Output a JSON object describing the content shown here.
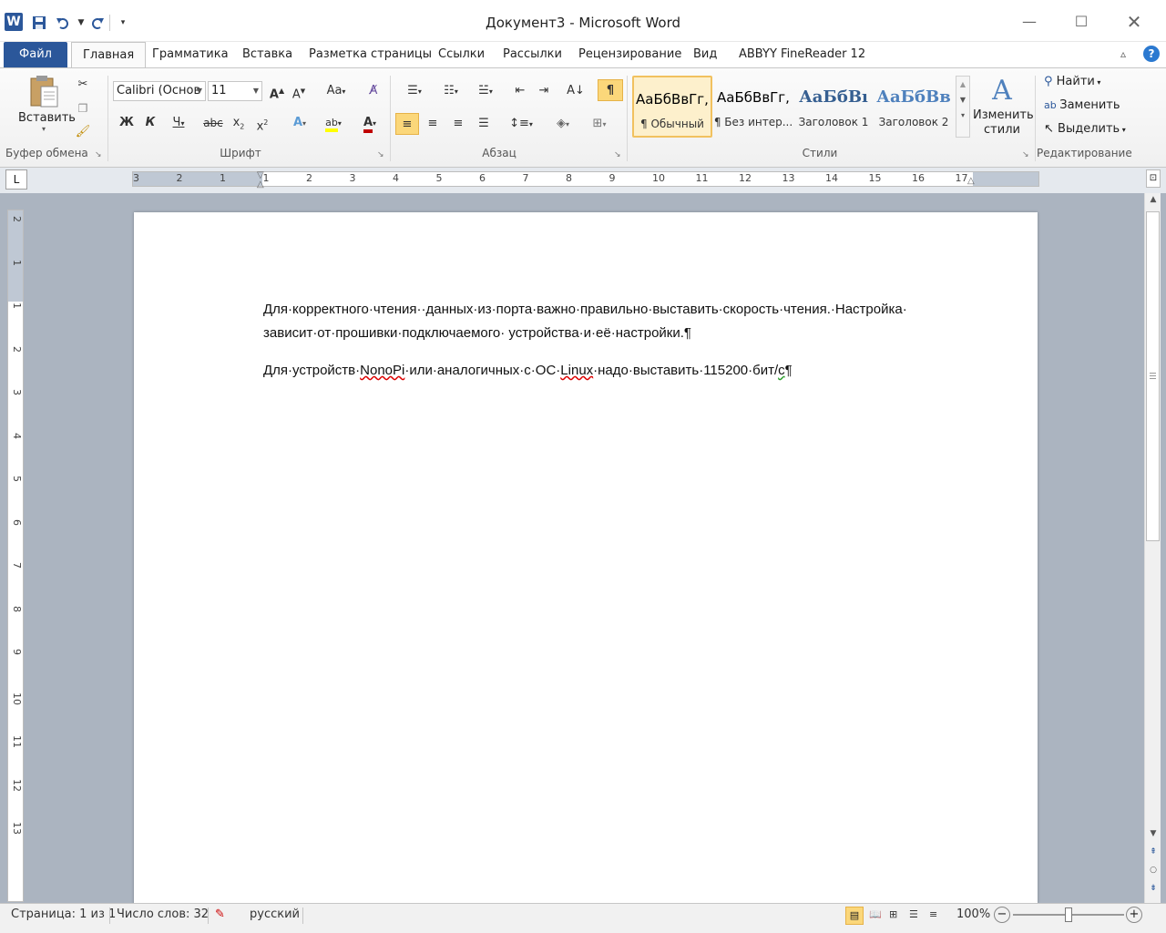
{
  "window": {
    "title": "Документ3 - Microsoft Word",
    "minimize_icon": "minimize-icon",
    "maximize_icon": "maximize-icon",
    "close_icon": "close-icon"
  },
  "qat": {
    "save_icon": "save-icon",
    "undo_icon": "undo-icon",
    "redo_icon": "redo-icon",
    "customize_icon": "chevron-down-icon"
  },
  "tabs": [
    "Файл",
    "Главная",
    "Грамматика",
    "Вставка",
    "Разметка страницы",
    "Ссылки",
    "Рассылки",
    "Рецензирование",
    "Вид",
    "ABBYY FineReader 12"
  ],
  "ribbon": {
    "clipboard": {
      "label": "Буфер обмена",
      "paste": "Вставить"
    },
    "font": {
      "label": "Шрифт",
      "name": "Calibri (Основ",
      "size": "11",
      "case_btn": "Аа"
    },
    "paragraph": {
      "label": "Абзац"
    },
    "styles": {
      "label": "Стили",
      "items": [
        {
          "sample": "АаБбВвГг,",
          "name": "¶ Обычный",
          "color": "#000000"
        },
        {
          "sample": "АаБбВвГг,",
          "name": "¶ Без интер...",
          "color": "#000000"
        },
        {
          "sample": "АаБбВı",
          "name": "Заголовок 1",
          "color": "#365f91"
        },
        {
          "sample": "АаБбВв",
          "name": "Заголовок 2",
          "color": "#4f81bd"
        }
      ],
      "change": "Изменить стили"
    },
    "editing": {
      "label": "Редактирование",
      "find": "Найти",
      "replace": "Заменить",
      "select": "Выделить"
    }
  },
  "ruler": {
    "h_labels": [
      "3",
      "2",
      "1",
      "1",
      "2",
      "3",
      "4",
      "5",
      "6",
      "7",
      "8",
      "9",
      "10",
      "11",
      "12",
      "13",
      "14",
      "15",
      "16",
      "17"
    ],
    "v_labels": [
      "2",
      "1",
      "1",
      "2",
      "3",
      "4",
      "5",
      "6",
      "7",
      "8",
      "9",
      "10",
      "11",
      "12",
      "13"
    ],
    "corner": "L"
  },
  "document": {
    "paragraphs": [
      "Для·корректного·чтения··данных·из·порта·важно·правильно·выставить·скорость·чтения.·Настройка· зависит·от·прошивки·подключаемого· устройства·и·её·настройки.¶"
    ],
    "p2_before": "Для·устройств·",
    "p2_nonopi": "NonoPi",
    "p2_mid": "·или·аналогичных·с·ОС·",
    "p2_linux": "Linux",
    "p2_after": "·надо·выставить·115200·бит/",
    "p2_c": "с",
    "p2_end": "¶"
  },
  "status": {
    "page": "Страница: 1 из 1",
    "words": "Число слов: 32",
    "language": "русский",
    "zoom": "100%",
    "zoom_level": 100
  }
}
